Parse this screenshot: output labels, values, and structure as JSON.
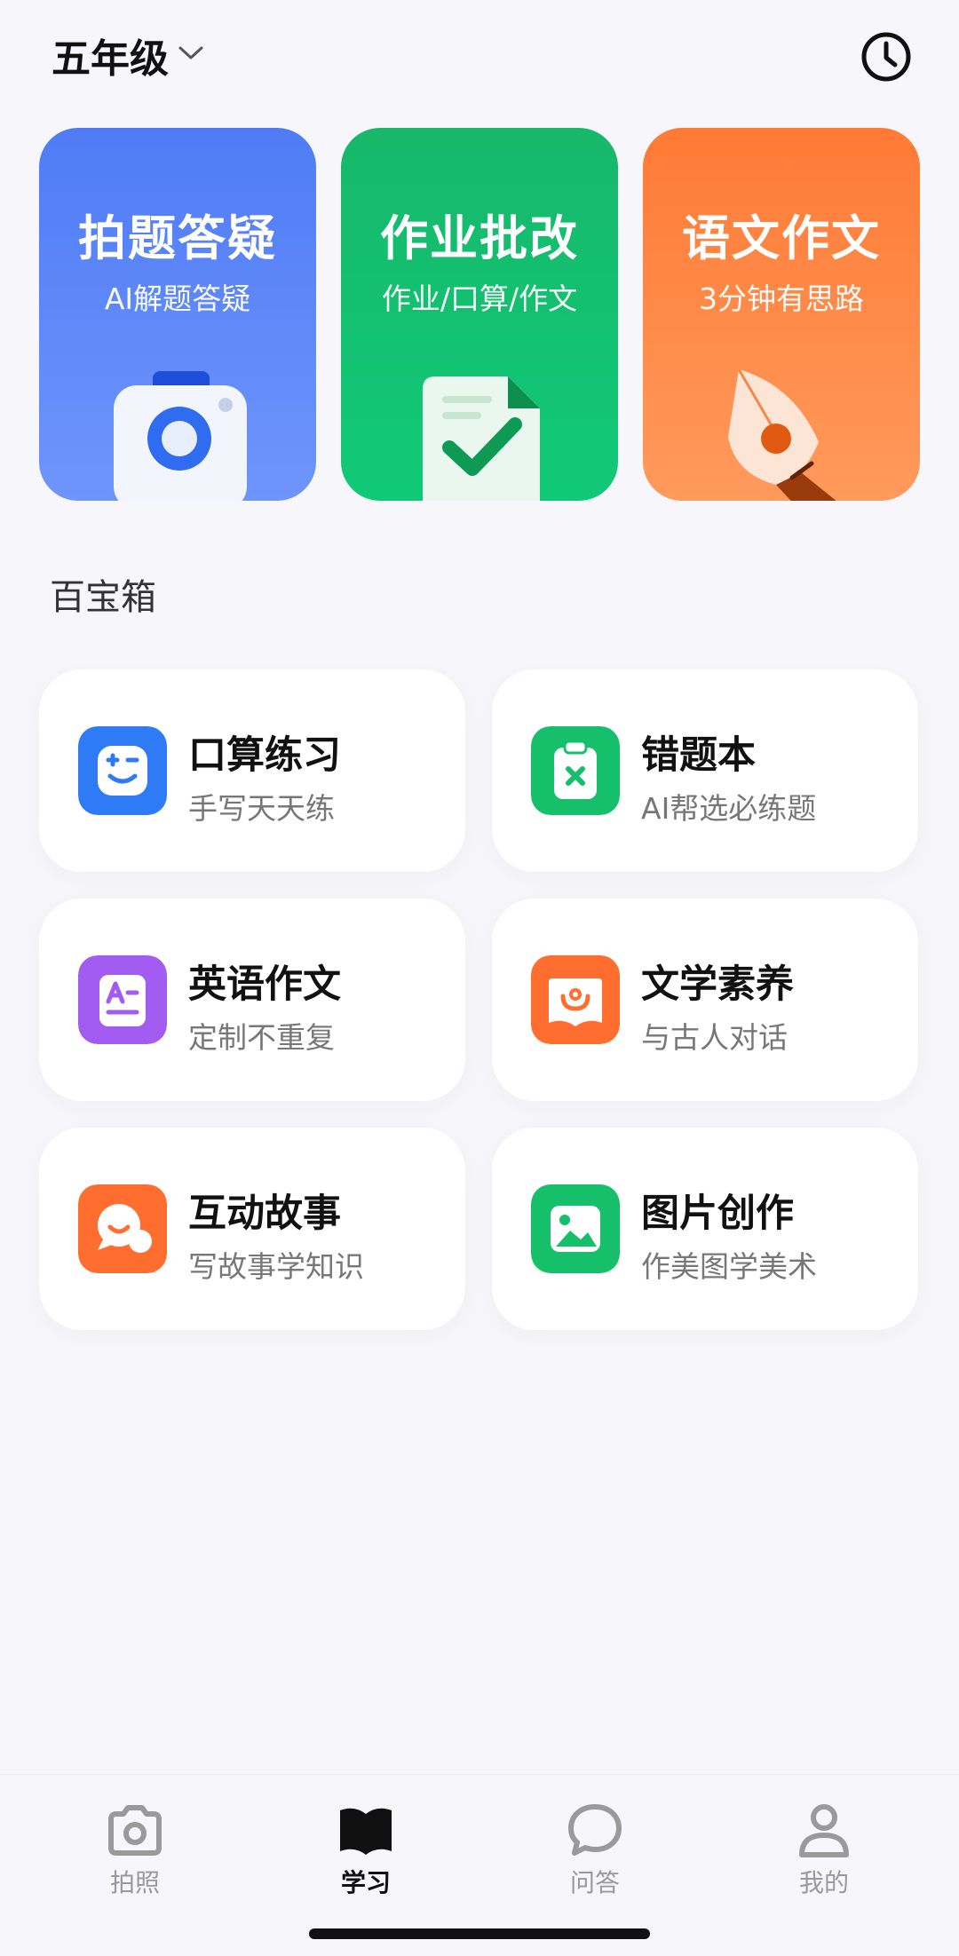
{
  "header": {
    "grade": "五年级",
    "history_icon": "clock-icon"
  },
  "feature_cards": [
    {
      "title": "拍题答疑",
      "subtitle": "AI解题答疑",
      "icon": "camera-icon",
      "color": "#4f7cf6"
    },
    {
      "title": "作业批改",
      "subtitle": "作业/口算/作文",
      "icon": "document-check-icon",
      "color": "#17b86a"
    },
    {
      "title": "语文作文",
      "subtitle": "3分钟有思路",
      "icon": "pen-nib-icon",
      "color": "#ff7a35"
    }
  ],
  "toolbox": {
    "title": "百宝箱",
    "items": [
      {
        "title": "口算练习",
        "subtitle": "手写天天练",
        "icon": "math-face-icon",
        "color": "#2f7bf5"
      },
      {
        "title": "错题本",
        "subtitle": "AI帮选必练题",
        "icon": "clipboard-x-icon",
        "color": "#16c06b"
      },
      {
        "title": "英语作文",
        "subtitle": "定制不重复",
        "icon": "letter-a-icon",
        "color": "#a25cf2"
      },
      {
        "title": "文学素养",
        "subtitle": "与古人对话",
        "icon": "open-book-icon",
        "color": "#ff6e2e"
      },
      {
        "title": "互动故事",
        "subtitle": "写故事学知识",
        "icon": "chat-bubbles-icon",
        "color": "#ff6e2e"
      },
      {
        "title": "图片创作",
        "subtitle": "作美图学美术",
        "icon": "image-icon",
        "color": "#16c06b"
      }
    ]
  },
  "tabbar": {
    "tabs": [
      {
        "label": "拍照",
        "icon": "camera-tab-icon",
        "active": false
      },
      {
        "label": "学习",
        "icon": "book-tab-icon",
        "active": true
      },
      {
        "label": "问答",
        "icon": "chat-tab-icon",
        "active": false
      },
      {
        "label": "我的",
        "icon": "user-tab-icon",
        "active": false
      }
    ]
  }
}
